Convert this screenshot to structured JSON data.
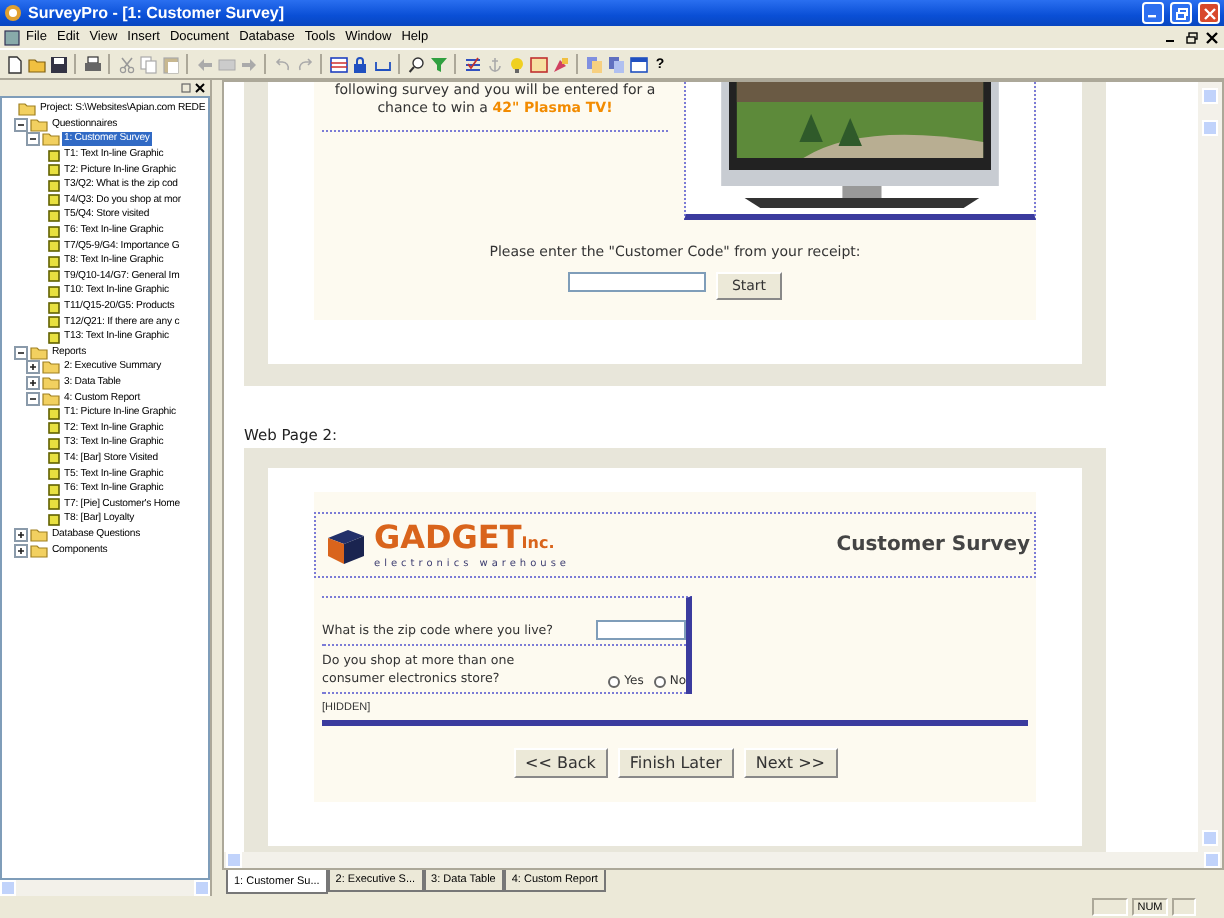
{
  "window": {
    "title": "SurveyPro - [1: Customer Survey]"
  },
  "menu": [
    "File",
    "Edit",
    "View",
    "Insert",
    "Document",
    "Database",
    "Tools",
    "Window",
    "Help"
  ],
  "toolbar": {
    "help_label": "?"
  },
  "tree": [
    {
      "label": "Project: S:\\Websites\\Apian.com REDE",
      "kind": "folder",
      "selected": false,
      "children": [
        {
          "label": "Questionnaires",
          "kind": "folder",
          "selected": false,
          "expanded": true,
          "children": [
            {
              "label": "1: Customer Survey",
              "kind": "folder",
              "selected": true,
              "expanded": true,
              "children": [
                {
                  "label": "T1: Text In-line Graphic",
                  "kind": "item",
                  "selected": false
                },
                {
                  "label": "T2: Picture In-line Graphic",
                  "kind": "item",
                  "selected": false
                },
                {
                  "label": "T3/Q2: What is the zip cod",
                  "kind": "item",
                  "selected": false
                },
                {
                  "label": "T4/Q3: Do you shop at mor",
                  "kind": "item",
                  "selected": false
                },
                {
                  "label": "T5/Q4: Store visited",
                  "kind": "item",
                  "selected": false
                },
                {
                  "label": "T6: Text In-line Graphic",
                  "kind": "item",
                  "selected": false
                },
                {
                  "label": "T7/Q5-9/G4: Importance G",
                  "kind": "item",
                  "selected": false
                },
                {
                  "label": "T8: Text In-line Graphic",
                  "kind": "item",
                  "selected": false
                },
                {
                  "label": "T9/Q10-14/G7: General Im",
                  "kind": "item",
                  "selected": false
                },
                {
                  "label": "T10: Text In-line Graphic",
                  "kind": "item",
                  "selected": false
                },
                {
                  "label": "T11/Q15-20/G5: Products",
                  "kind": "item",
                  "selected": false
                },
                {
                  "label": "T12/Q21: If there are any c",
                  "kind": "item",
                  "selected": false
                },
                {
                  "label": "T13: Text In-line Graphic",
                  "kind": "item",
                  "selected": false
                }
              ]
            }
          ]
        },
        {
          "label": "Reports",
          "kind": "folder",
          "selected": false,
          "expanded": true,
          "children": [
            {
              "label": "2: Executive Summary",
              "kind": "folder",
              "selected": false,
              "expanded": false
            },
            {
              "label": "3: Data Table",
              "kind": "folder",
              "selected": false,
              "expanded": false
            },
            {
              "label": "4: Custom Report",
              "kind": "folder",
              "selected": false,
              "expanded": true,
              "children": [
                {
                  "label": "T1: Picture In-line Graphic",
                  "kind": "item",
                  "selected": false
                },
                {
                  "label": "T2: Text In-line Graphic",
                  "kind": "item",
                  "selected": false
                },
                {
                  "label": "T3: Text In-line Graphic",
                  "kind": "item",
                  "selected": false
                },
                {
                  "label": "T4: [Bar] Store Visited",
                  "kind": "item",
                  "selected": false
                },
                {
                  "label": "T5: Text In-line Graphic",
                  "kind": "item",
                  "selected": false
                },
                {
                  "label": "T6: Text In-line Graphic",
                  "kind": "item",
                  "selected": false
                },
                {
                  "label": "T7: [Pie] Customer's Home",
                  "kind": "item",
                  "selected": false
                },
                {
                  "label": "T8: [Bar] Loyalty",
                  "kind": "item",
                  "selected": false
                }
              ]
            }
          ]
        },
        {
          "label": "Database Questions",
          "kind": "folder",
          "selected": false,
          "expanded": false
        },
        {
          "label": "Components",
          "kind": "folder",
          "selected": false,
          "expanded": false
        }
      ]
    }
  ],
  "page1": {
    "intro_line": "following survey and you will be entered for a",
    "prize_prefix": "chance to win a ",
    "prize": "42\" Plasma TV!",
    "prompt": "Please enter the \"Customer Code\" from your receipt:",
    "start_button": "Start"
  },
  "page2": {
    "label": "Web Page 2:",
    "logo": {
      "name": "GADGET",
      "suffix": "Inc.",
      "tagline": "electronics warehouse"
    },
    "title": "Customer Survey",
    "questions": [
      {
        "kind": "text",
        "text": "What is the zip code where you live?"
      },
      {
        "kind": "radio",
        "text": "Do you shop at more than one consumer electronics store?",
        "options": [
          {
            "label": "Yes",
            "selected": false
          },
          {
            "label": "No",
            "selected": false
          }
        ]
      }
    ],
    "hidden_label": "[HIDDEN]",
    "buttons": [
      "<< Back",
      "Finish Later",
      "Next >>"
    ]
  },
  "tabs": [
    {
      "label": "1: Customer Su...",
      "selected": true
    },
    {
      "label": "2: Executive S...",
      "selected": false
    },
    {
      "label": "3: Data Table",
      "selected": false
    },
    {
      "label": "4: Custom Report",
      "selected": false
    }
  ],
  "status_bar": {
    "num": "NUM"
  }
}
